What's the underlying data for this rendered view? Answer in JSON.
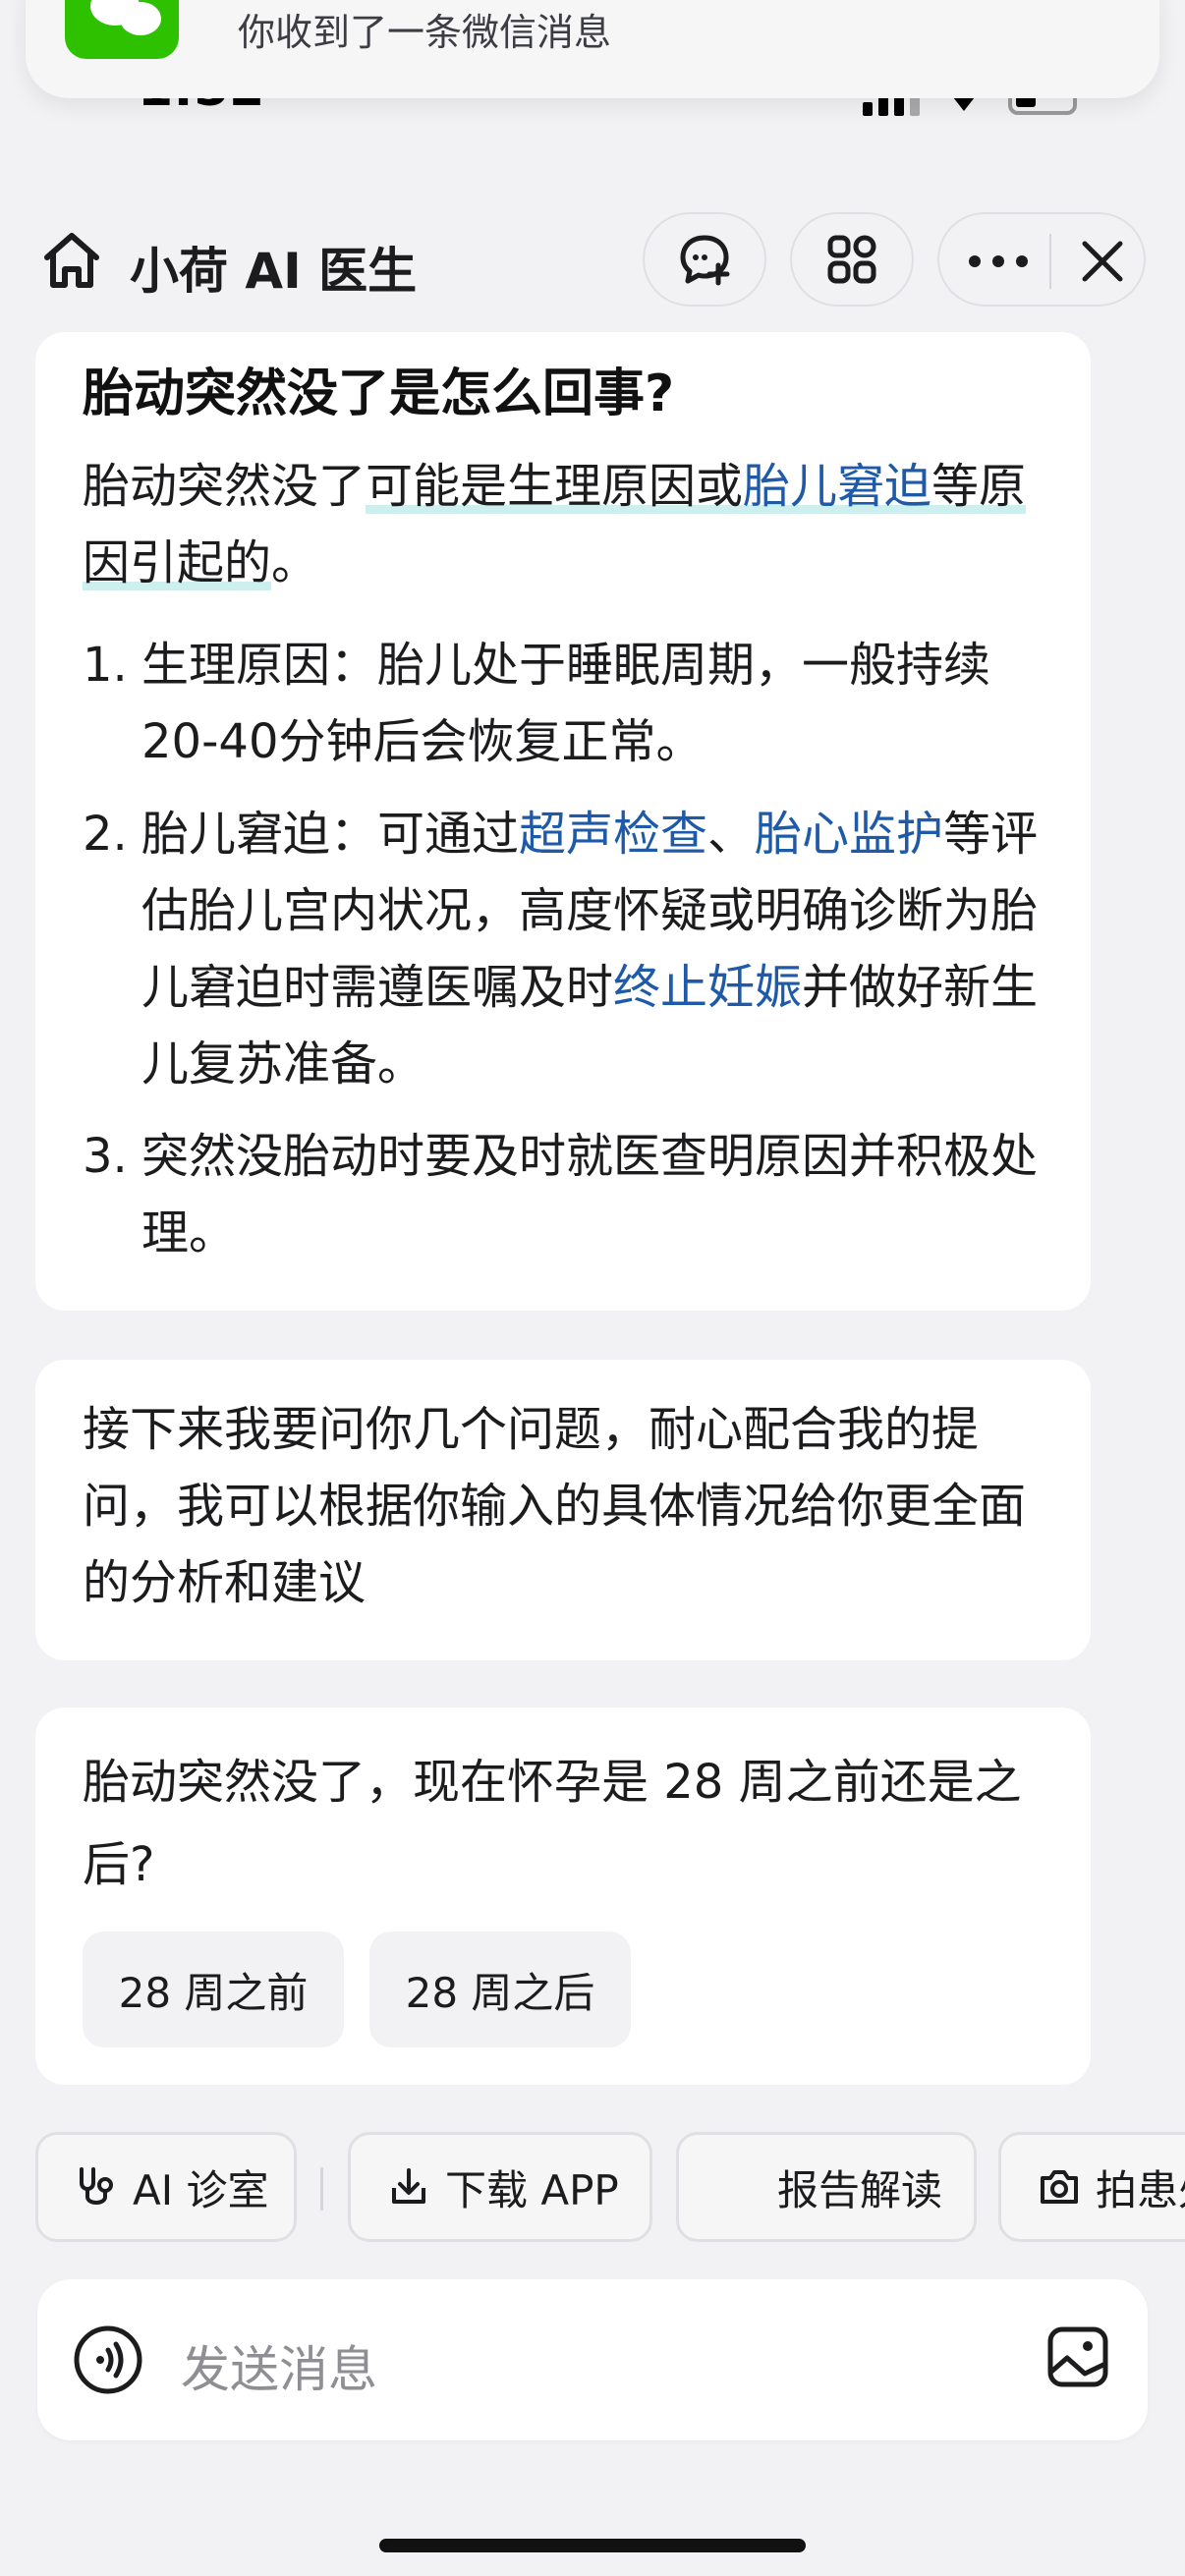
{
  "notification": {
    "text": "你收到了一条微信消息",
    "app": "wechat"
  },
  "status_bar": {
    "time": "1:52"
  },
  "header": {
    "home_icon": "home-icon",
    "title": "小荷 AI 医生",
    "buttons": [
      "chat-plus-icon",
      "grid-icon",
      "more-icon",
      "close-icon"
    ]
  },
  "answer_card": {
    "title": "胎动突然没了是怎么回事?",
    "lead": {
      "p1": "胎动突然没了",
      "p2": "可能是生理原因或",
      "p3": "胎儿窘迫",
      "p4": "等原因引起的",
      "p5": "。"
    },
    "items": [
      {
        "num": "1.",
        "text": "生理原因：胎儿处于睡眠周期，一般持续20-40分钟后会恢复正常。"
      },
      {
        "num": "2.",
        "a": "胎儿窘迫：可通过",
        "link1": "超声检查",
        "b": "、",
        "link2": "胎心监护",
        "c": "等评估胎儿宫内状况，高度怀疑或明确诊断为胎儿窘迫时需遵医嘱及时",
        "link3": "终止妊娠",
        "d": "并做好新生儿复苏准备。"
      },
      {
        "num": "3.",
        "text": "突然没胎动时要及时就医查明原因并积极处理。"
      }
    ]
  },
  "intro_card": {
    "text": "接下来我要问你几个问题，耐心配合我的提问，我可以根据你输入的具体情况给你更全面的分析和建议"
  },
  "question_card": {
    "text": "胎动突然没了，现在怀孕是 28 周之前还是之后?",
    "options": [
      "28 周之前",
      "28 周之后"
    ]
  },
  "chips": {
    "ai_clinic": "AI 诊室",
    "download": "下载 APP",
    "report": "报告解读",
    "photo": "拍患处"
  },
  "input": {
    "placeholder": "发送消息"
  },
  "colors": {
    "link": "#1f5aa8",
    "highlight": "#cdf0ef",
    "wechat": "#2dc100"
  }
}
